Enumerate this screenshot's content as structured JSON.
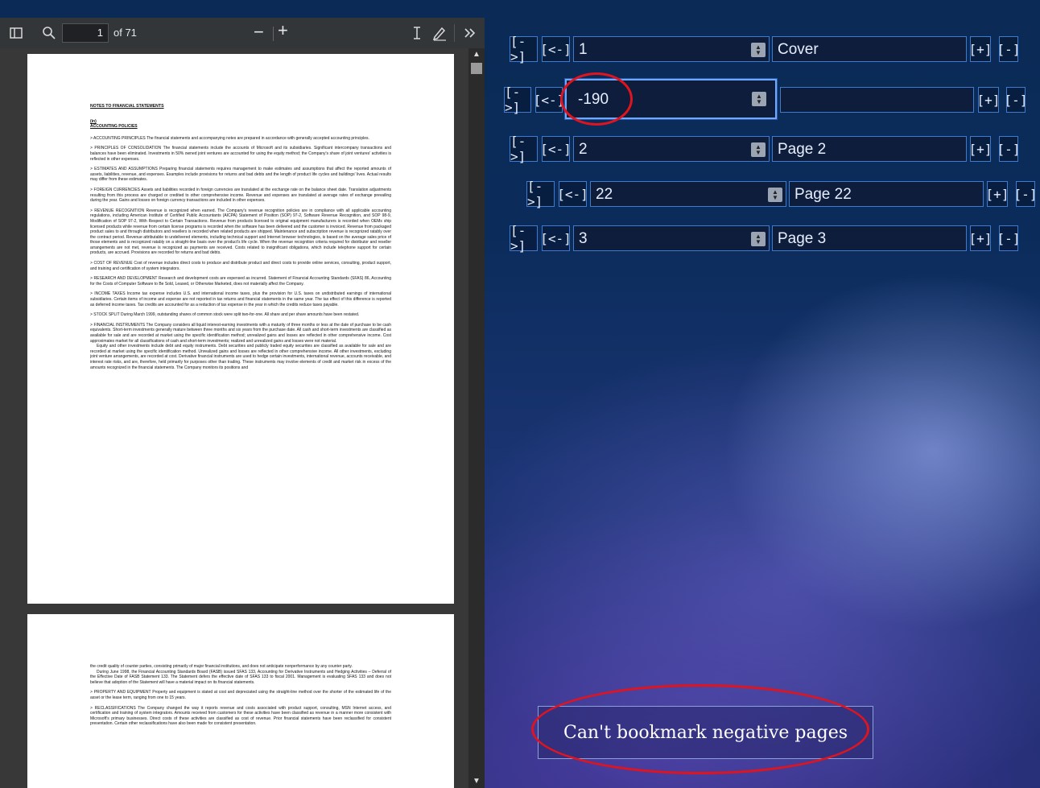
{
  "pdf_viewer": {
    "page_current": "1",
    "page_total": "of 71",
    "zoom_out": "−",
    "zoom_in": "+",
    "scroll_up": "▲",
    "scroll_down": "▼",
    "page1": {
      "heading": "NOTES TO FINANCIAL STATEMENTS",
      "section_sub1": "(in)",
      "section_sub2": "ACCOUNTING POLICIES",
      "paragraphs": [
        "> ACCOUNTING PRINCIPLES   The financial statements and accompanying notes are prepared in accordance with generally accepted accounting principles.",
        "> PRINCIPLES OF CONSOLIDATION   The financial statements include the accounts of Microsoft and its subsidiaries. Significant intercompany transactions and balances have been eliminated. Investments in 50% owned joint ventures are accounted for using the equity method; the Company's share of joint ventures' activities is reflected in other expenses.",
        "> ESTIMATES AND ASSUMPTIONS   Preparing financial statements requires management to make estimates and assumptions that affect the reported amounts of assets, liabilities, revenue, and expenses. Examples include provisions for returns and bad debts and the length of product life cycles and buildings' lives. Actual results may differ from these estimates.",
        "> FOREIGN CURRENCIES   Assets and liabilities recorded in foreign currencies are translated at the exchange rate on the balance sheet date. Translation adjustments resulting from this process are charged or credited to other comprehensive income. Revenue and expenses are translated at average rates of exchange prevailing during the year. Gains and losses on foreign currency transactions are included in other expenses.",
        "> REVENUE RECOGNITION   Revenue is recognized when earned. The Company's revenue recognition policies are in compliance with all applicable accounting regulations, including American Institute of Certified Public Accountants (AICPA) Statement of Position (SOP) 97-2, Software Revenue Recognition, and SOP 98-9, Modification of SOP 97-2, With Respect to Certain Transactions. Revenue from products licensed to original equipment manufacturers is recorded when OEMs ship licensed products while revenue from certain license programs is recorded when the software has been delivered and the customer is invoiced. Revenue from packaged product sales to and through distributors and resellers is recorded when related products are shipped. Maintenance and subscription revenue is recognized ratably over the contract period. Revenue attributable to undelivered elements, including technical support and Internet browser technologies, is based on the average sales price of those elements and is recognized ratably on a straight-line basis over the product's life cycle. When the revenue recognition criteria required for distributor and reseller arrangements are not met, revenue is recognized as payments are received. Costs related to insignificant obligations, which include telephone support for certain products, are accrued. Provisions are recorded for returns and bad debts.",
        "> COST OF REVENUE   Cost of revenue includes direct costs to produce and distribute product and direct costs to provide online services, consulting, product support, and training and certification of system integrators.",
        "> RESEARCH AND DEVELOPMENT   Research and development costs are expensed as incurred. Statement of Financial Accounting Standards (SFAS) 86, Accounting for the Costs of Computer Software to Be Sold, Leased, or Otherwise Marketed, does not materially affect the Company.",
        "> INCOME TAXES   Income tax expense includes U.S. and international income taxes, plus the provision for U.S. taxes on undistributed earnings of international subsidiaries. Certain items of income and expense are not reported in tax returns and financial statements in the same year. The tax effect of this difference is reported as deferred income taxes. Tax credits are accounted for as a reduction of tax expense in the year in which the credits reduce taxes payable.",
        "> STOCK SPLIT   During March 1999, outstanding shares of common stock were split two-for-one. All share and per share amounts have been restated.",
        "> FINANCIAL INSTRUMENTS   The Company considers all liquid interest-earning investments with a maturity of three months or less at the date of purchase to be cash equivalents. Short-term investments generally mature between three months and six years from the purchase date. All cash and short-term investments are classified as available for sale and are recorded at market using the specific identification method; unrealized gains and losses are reflected in other comprehensive income. Cost approximates market for all classifications of cash and short-term investments; realized and unrealized gains and losses were not material.",
        "Equity and other investments include debt and equity instruments. Debt securities and publicly traded equity securities are classified as available for sale and are recorded at market using the specific identification method. Unrealized gains and losses are reflected in other comprehensive income. All other investments, excluding joint venture arrangements, are recorded at cost. Derivative financial instruments are used to hedge certain investments, international revenue, accounts receivable, and interest rate risks, and are, therefore, held primarily for purposes other than trading. These instruments may involve elements of credit and market risk in excess of the amounts recognized in the financial statements. The Company monitors its positions and"
      ]
    },
    "page2": {
      "paragraphs": [
        "the credit quality of counter parties, consisting primarily of major financial institutions, and does not anticipate nonperformance by any counter party.",
        "During June 1998, the Financial Accounting Standards Board (FASB) issued SFAS 133, Accounting for Derivative Instruments and Hedging Activities – Deferral of the Effective Date of FASB Statement 133. The Statement defers the effective date of SFAS 133 to fiscal 2001. Management is evaluating SFAS 133 and does not believe that adoption of the Statement will have a material impact on its financial statements.",
        "> PROPERTY AND EQUIPMENT   Property and equipment is stated at cost and depreciated using the straight-line method over the shorter of the estimated life of the asset or the lease term, ranging from one to 15 years.",
        "> RECLASSIFICATIONS   The Company changed the way it reports revenue and costs associated with product support, consulting, MSN Internet access, and certification and training of system integrators. Amounts received from customers for these activities have been classified as revenue in a manner more consistent with Microsoft's primary businesses. Direct costs of these activities are classified as cost of revenue. Prior financial statements have been reclassified for consistent presentation. Certain other reclassifications have also been made for consistent presentation."
      ]
    }
  },
  "bookmarks": {
    "rows": [
      {
        "goto": "[->]",
        "back": "[<-]",
        "number": "1",
        "title": "Cover",
        "add": "[+]",
        "remove": "[-]"
      },
      {
        "goto": "[->]",
        "back": "[<-]",
        "number": "-190",
        "title": "",
        "add": "[+]",
        "remove": "[-]"
      },
      {
        "goto": "[->]",
        "back": "[<-]",
        "number": "2",
        "title": "Page 2",
        "add": "[+]",
        "remove": "[-]"
      },
      {
        "goto": "[->]",
        "back": "[<-]",
        "number": "22",
        "title": "Page 22",
        "add": "[+]",
        "remove": "[-]"
      },
      {
        "goto": "[->]",
        "back": "[<-]",
        "number": "3",
        "title": "Page 3",
        "add": "[+]",
        "remove": "[-]"
      }
    ]
  },
  "toast": {
    "message": "Can't bookmark negative pages"
  },
  "colors": {
    "accent_border": "#3d7bd0",
    "annotation": "#e0141e"
  }
}
